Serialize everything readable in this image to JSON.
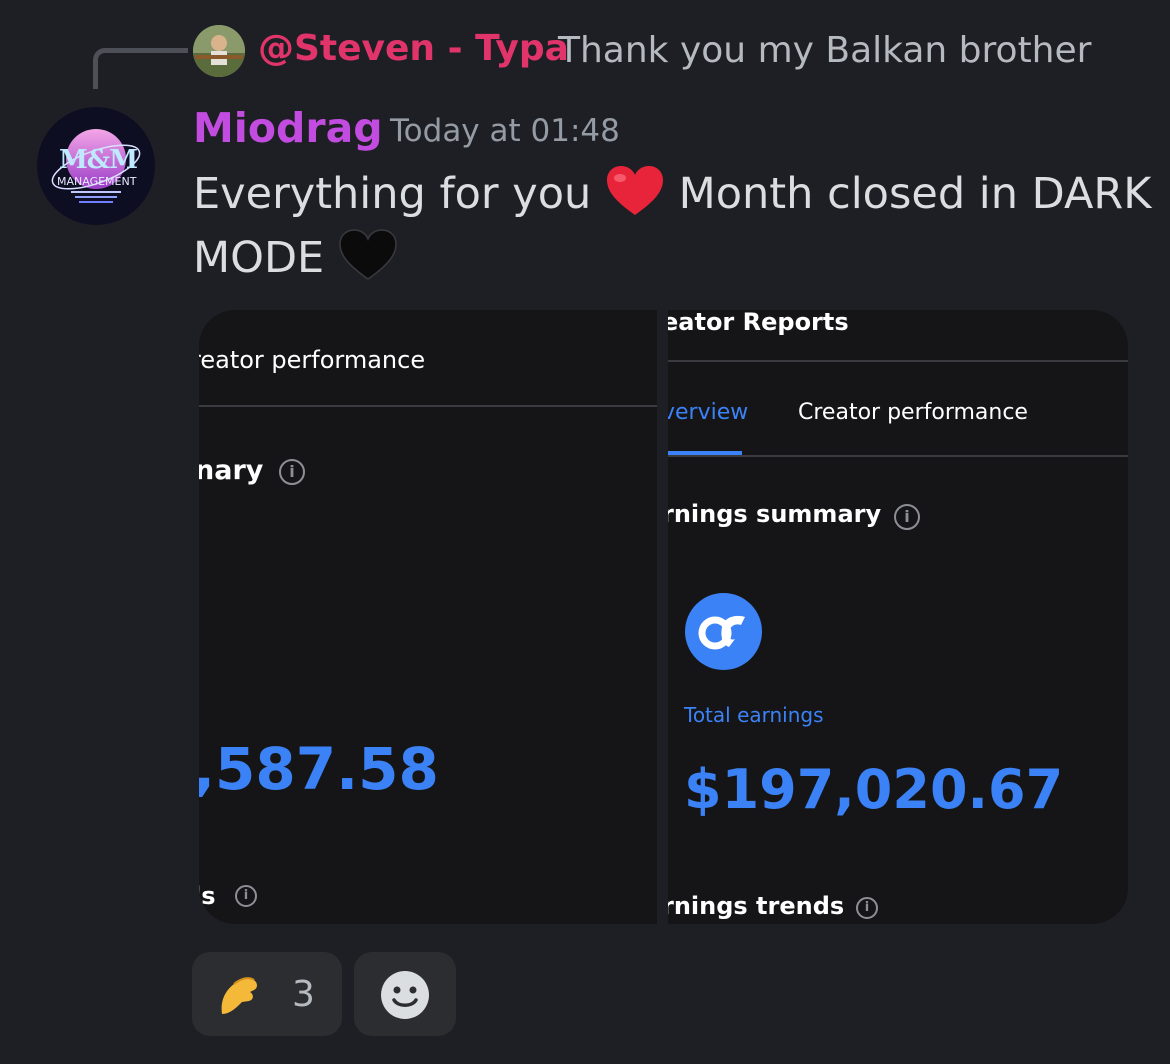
{
  "reply": {
    "author": "@Steven - Typa",
    "text": "Thank you my Balkan brother"
  },
  "message": {
    "author": "Miodrag",
    "timestamp": "Today at 01:48",
    "line1_before": "Everything for you",
    "line1_after": "Month closed in DARK",
    "line2": "MODE",
    "emojis": [
      "red-heart",
      "black-heart"
    ]
  },
  "avatar_logo": {
    "mark": "M&M",
    "subtitle": "MANAGEMENT"
  },
  "image1": {
    "tab_label": "reator performance",
    "section_label": "nary",
    "amount": ",587.58",
    "bottom_label": "ls"
  },
  "image2": {
    "title": "eator Reports",
    "tab_overview": "verview",
    "tab_creator": "Creator performance",
    "section_title": "rnings summary",
    "total_label": "Total earnings",
    "amount": "$197,020.67",
    "bottom_title": "rnings trends"
  },
  "reactions": [
    {
      "emoji": "pinched-fingers",
      "count": "3"
    }
  ],
  "colors": {
    "accent_blue": "#3b82f6",
    "reply_author": "#e0346b",
    "author": "#c34ce0"
  }
}
